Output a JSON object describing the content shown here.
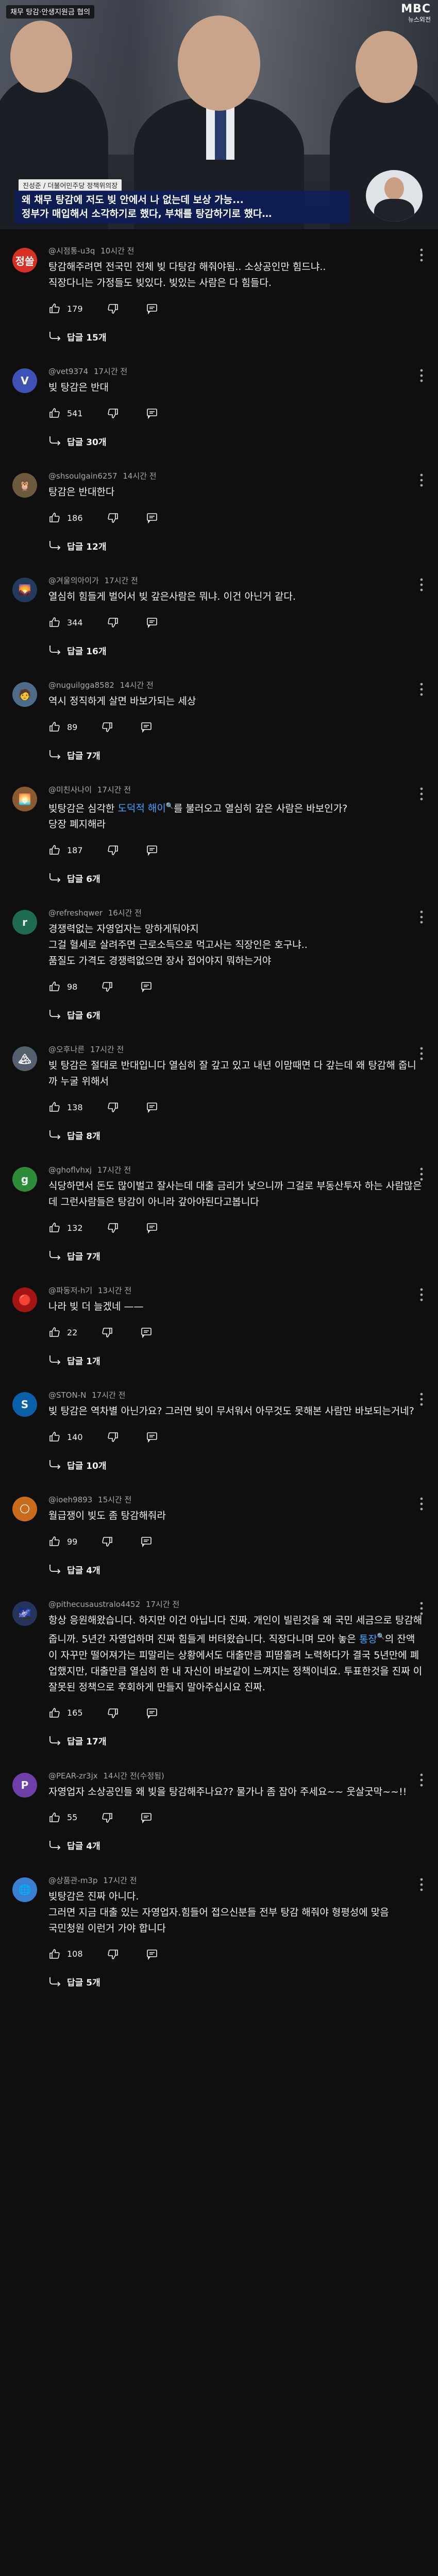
{
  "video": {
    "top_tag": "채무 탕감·안생지원금 협의",
    "channel_logo": "MBC",
    "channel_sub": "뉴스외전",
    "speaker": "진성준 / 더불어민주당 정책위의장",
    "caption_line1": "왜 채무 탕감에 저도 빚 안에서 나 없는데 보상 가능...",
    "caption_line2": "정부가 매입해서 소각하기로 했다, 부채를 탕감하기로 했다…"
  },
  "comments": [
    {
      "id": "c1",
      "author": "@시점통-u3q",
      "time": "10시간 전",
      "text": "탕감해주려면 전국민 전체 빚 다탕감 해줘야됨.. 소상공인만 힘드냐..\n직장다니는 가정들도 빚있다.  빚있는 사람은 다 힘들다.",
      "likes": "179",
      "replies": "답글 15개",
      "avatar_text": "정쓸",
      "avatar_color": "#d93025"
    },
    {
      "id": "c2",
      "author": "@vet9374",
      "time": "17시간 전",
      "text": "빚 탕감은 반대",
      "likes": "541",
      "replies": "답글 30개",
      "avatar_text": "V",
      "avatar_color": "#3f51b5"
    },
    {
      "id": "c3",
      "author": "@shsoulgain6257",
      "time": "14시간 전",
      "text": "탕감은 반대한다",
      "likes": "186",
      "replies": "답글 12개",
      "avatar_text": "🦉",
      "avatar_color": "#6d5a3e"
    },
    {
      "id": "c4",
      "author": "@겨울의아이가",
      "time": "17시간 전",
      "text": "열심히 힘들게 벌어서 빚 갚은사람은 뭐냐. 이건 아닌거 같다.",
      "likes": "344",
      "replies": "답글 16개",
      "avatar_text": "🌄",
      "avatar_color": "#233a5e"
    },
    {
      "id": "c5",
      "author": "@nuguilgga8582",
      "time": "14시간 전",
      "text": "역시 정직하게 살면 바보가되는 세상",
      "likes": "89",
      "replies": "답글 7개",
      "avatar_text": "🧑",
      "avatar_color": "#4e6b89"
    },
    {
      "id": "c6",
      "author": "@미친사나이",
      "time": "17시간 전",
      "text_before": "빚탕감은 심각한 ",
      "chip": "도덕적 해이",
      "text_after": "를 불러오고 열심히 갚은 사람은 바보인가?\n당장 폐지해라",
      "likes": "187",
      "replies": "답글 6개",
      "avatar_text": "🌅",
      "avatar_color": "#8a5b32"
    },
    {
      "id": "c7",
      "author": "@refreshqwer",
      "time": "16시간 전",
      "text": "경쟁력없는 자영업자는 망하게둬야지\n그걸 혈세로 살려주면 근로소득으로 먹고사는 직장인은 호구냐..\n품질도 가격도 경쟁력없으면 장사 접어야지 뭐하는거야",
      "likes": "98",
      "replies": "답글 6개",
      "avatar_text": "r",
      "avatar_color": "#1e6b52"
    },
    {
      "id": "c8",
      "author": "@오후나른",
      "time": "17시간 전",
      "text": "빚 탕감은 절대로 반대입니다 열심히 잘 갚고 있고 내년 이맘때면 다 갚는데 왜 탕감해 줍니까 누굴 위해서",
      "likes": "138",
      "replies": "답글 8개",
      "avatar_text": "🏔",
      "avatar_color": "#55606e"
    },
    {
      "id": "c9",
      "author": "@ghoflvhxj",
      "time": "17시간 전",
      "text": "식당하면서 돈도 많이벌고 잘사는데 대출 금리가 낮으니까 그걸로 부동산투자  하는 사람많은데 그런사람들은 탕감이 아니라 갚아야된다고봅니다",
      "likes": "132",
      "replies": "답글 7개",
      "avatar_text": "g",
      "avatar_color": "#2e8b3a"
    },
    {
      "id": "c10",
      "author": "@파동저-h기",
      "time": "13시간 전",
      "text": "나라 빚 더 늘겠네 ——",
      "likes": "22",
      "replies": "답글 1개",
      "avatar_text": "🔴",
      "avatar_color": "#a31414"
    },
    {
      "id": "c11",
      "author": "@STON-N",
      "time": "17시간 전",
      "text": "빚 탕감은 역차별 아닌가요? 그러면 빚이 무서워서 아무것도 못해본 사람만 바보되는거네?",
      "likes": "140",
      "replies": "답글 10개",
      "avatar_text": "S",
      "avatar_color": "#0b5ea8"
    },
    {
      "id": "c12",
      "author": "@ioeh9893",
      "time": "15시간 전",
      "text": "월급쟁이 빚도 좀 탕감해줘라",
      "likes": "99",
      "replies": "답글 4개",
      "avatar_text": "🌕",
      "avatar_color": "#c96b1c"
    },
    {
      "id": "c13",
      "author": "@pithecusaustralo4452",
      "time": "17시간 전",
      "text_before": "항상 응원해왔습니다. 하지만 이건 아닙니다 진짜. 개인이 빌린것을 왜 국민 세금으로 탕감해줍니까. 5년간 자영업하며 진짜 힘들게 버텨왔습니다. 직장다니며 모아 놓은 ",
      "chip": "통장",
      "text_after": "의 잔액이 자꾸만 떨어져가는 피말리는 상황에서도 대출만큼 피땀흘려 노력하다가 결국 5년만에 폐업했지만, 대출만큼 열심히 한 내 자신이 바보같이 느껴지는 정책이네요. 투표한것을 진짜 이 잘못된 정책으로 후회하게 만들지 말아주십시요 진짜.",
      "likes": "165",
      "replies": "답글 17개",
      "avatar_text": "🌌",
      "avatar_color": "#26335a"
    },
    {
      "id": "c14",
      "author": "@PEAR-zr3jx",
      "time": "14시간 전(수정됨)",
      "text": "자영업자 소상공인들  왜 빚을 탕감해주나요??   물가나 좀 잡아 주세요~~   웃살굿막~~!!",
      "likes": "55",
      "replies": "답글 4개",
      "avatar_text": "P",
      "avatar_color": "#6f3fa8"
    },
    {
      "id": "c15",
      "author": "@상품관-m3p",
      "time": "17시간 전",
      "text": "빚탕감은 진짜 아니다.\n그러면 지금 대출 있는 자영업자.힘들어 접으신분들 전부 탕감 해줘야 형평성에 맞음\n국민청원 이런거 가야 합니다",
      "likes": "108",
      "replies": "답글 5개",
      "avatar_text": "🌐",
      "avatar_color": "#3b7fd1"
    }
  ]
}
